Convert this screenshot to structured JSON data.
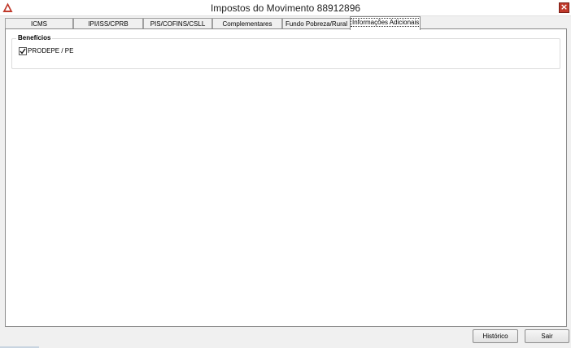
{
  "window": {
    "title": "Impostos do Movimento 88912896",
    "close_label": "×"
  },
  "tabs": [
    {
      "label": "ICMS",
      "active": false
    },
    {
      "label": "IPI/ISS/CPRB",
      "active": false
    },
    {
      "label": "PIS/COFINS/CSLL",
      "active": false
    },
    {
      "label": "Complementares",
      "active": false
    },
    {
      "label": "Fundo Pobreza/Rural",
      "active": false
    },
    {
      "label": "Informações Adicionais",
      "active": true
    }
  ],
  "group": {
    "title": "Benefícios",
    "items": [
      {
        "label": "PRODEPE / PE",
        "checked": true
      }
    ]
  },
  "footer": {
    "history_label": "Histórico",
    "exit_label": "Sair"
  },
  "colors": {
    "accent_red": "#c0392b",
    "panel_bg": "#ffffff",
    "window_bg": "#f0f0f0"
  }
}
